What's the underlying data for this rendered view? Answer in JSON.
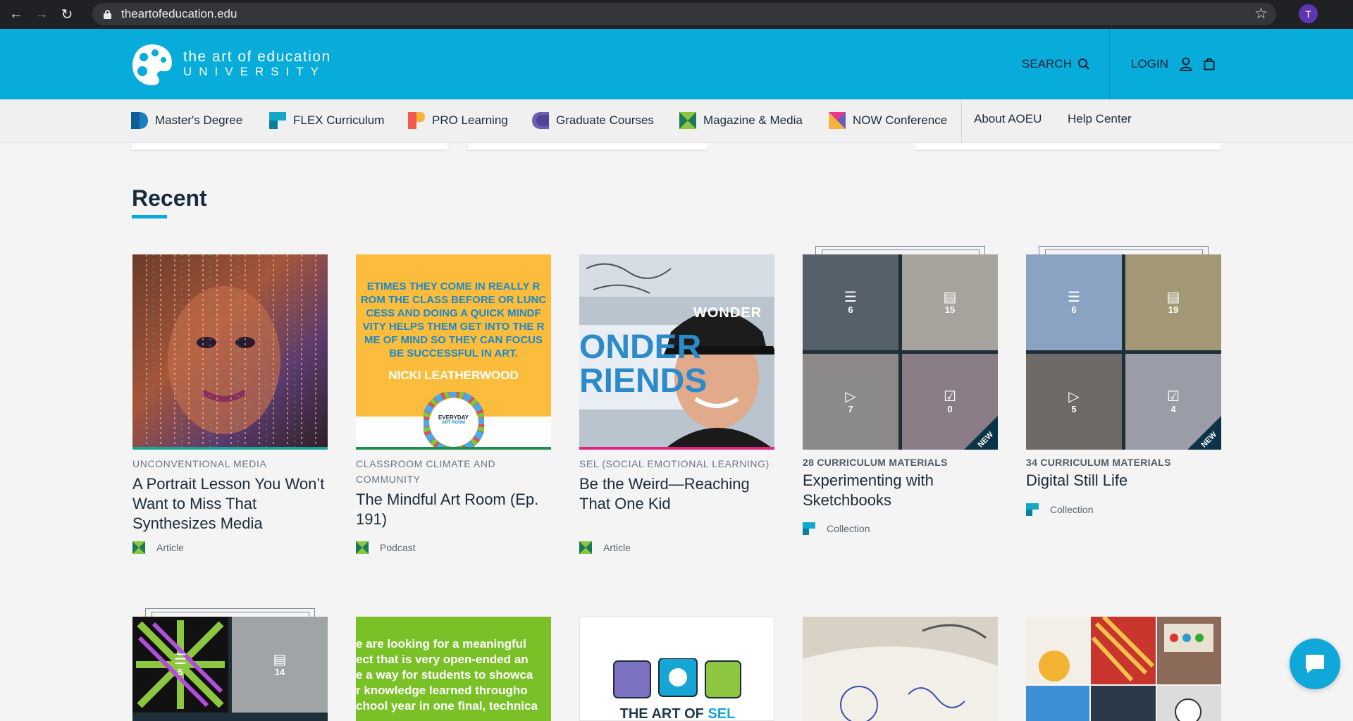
{
  "browser": {
    "url": "theartofeducation.edu",
    "profile_initial": "T"
  },
  "header": {
    "logo_line1": "the art of education",
    "logo_line2": "UNIVERSITY",
    "search_label": "SEARCH",
    "login_label": "LOGIN"
  },
  "nav": {
    "items": [
      {
        "label": "Master's Degree",
        "color1": "#1a7fc1",
        "color2": "#0e5e96"
      },
      {
        "label": "FLEX Curriculum",
        "color1": "#13a8c9",
        "color2": "#0c7f9a"
      },
      {
        "label": "PRO Learning",
        "color1": "#f05a4f",
        "color2": "#f6b53a"
      },
      {
        "label": "Graduate Courses",
        "color1": "#6a5fb7",
        "color2": "#4e4596"
      },
      {
        "label": "Magazine & Media",
        "color1": "#8dc63f",
        "color2": "#1a7a57"
      },
      {
        "label": "NOW Conference",
        "color1": "#e8378f",
        "color2": "#f4b33a"
      }
    ],
    "secondary": [
      "About AOEU",
      "Help Center"
    ]
  },
  "section": {
    "title": "Recent"
  },
  "cards": [
    {
      "category": "UNCONVENTIONAL MEDIA",
      "title": "A Portrait Lesson You Won’t Want to Miss That Synthesizes Media",
      "type": "Article",
      "bar_color": "#1aa49a"
    },
    {
      "category": "CLASSROOM CLIMATE AND COMMUNITY",
      "title": "The Mindful Art Room (Ep. 191)",
      "type": "Podcast",
      "bar_color": "#1a8f4f",
      "image_text": [
        "ETIMES THEY COME IN REALLY R",
        "ROM THE CLASS BEFORE OR LUNC",
        "CESS AND DOING A QUICK MINDF",
        "VITY HELPS THEM GET INTO THE R",
        "ME OF MIND SO THEY CAN FOCUS",
        "BE SUCCESSFUL IN ART."
      ],
      "image_name": "NICKI LEATHERWOOD",
      "image_badge_1": "EVERYDAY",
      "image_badge_2": "ART ROOM"
    },
    {
      "category": "SEL (SOCIAL EMOTIONAL LEARNING)",
      "title": "Be the Weird—Reaching That One Kid",
      "type": "Article",
      "bar_color": "#e0247f",
      "image_text_1": "ONDER",
      "image_text_2": "RIENDS",
      "cap_text": "WONDER"
    },
    {
      "category": "28 CURRICULUM MATERIALS",
      "title": "Experimenting with Sketchbooks",
      "type": "Collection",
      "counts": [
        "6",
        "15",
        "7",
        "0"
      ],
      "badge": "NEW"
    },
    {
      "category": "34 CURRICULUM MATERIALS",
      "title": "Digital Still Life",
      "type": "Collection",
      "counts": [
        "6",
        "19",
        "5",
        "4"
      ],
      "badge": "NEW"
    }
  ],
  "row2": {
    "card1_counts": [
      "5",
      "14"
    ],
    "card2_text": [
      "e are looking for a meaningful",
      "ect that is very open-ended an",
      "e a way for students to showca",
      "r knowledge learned througho",
      "chool year in one final, technica"
    ],
    "card3_text_1": "THE ART OF ",
    "card3_text_2": "SEL"
  }
}
